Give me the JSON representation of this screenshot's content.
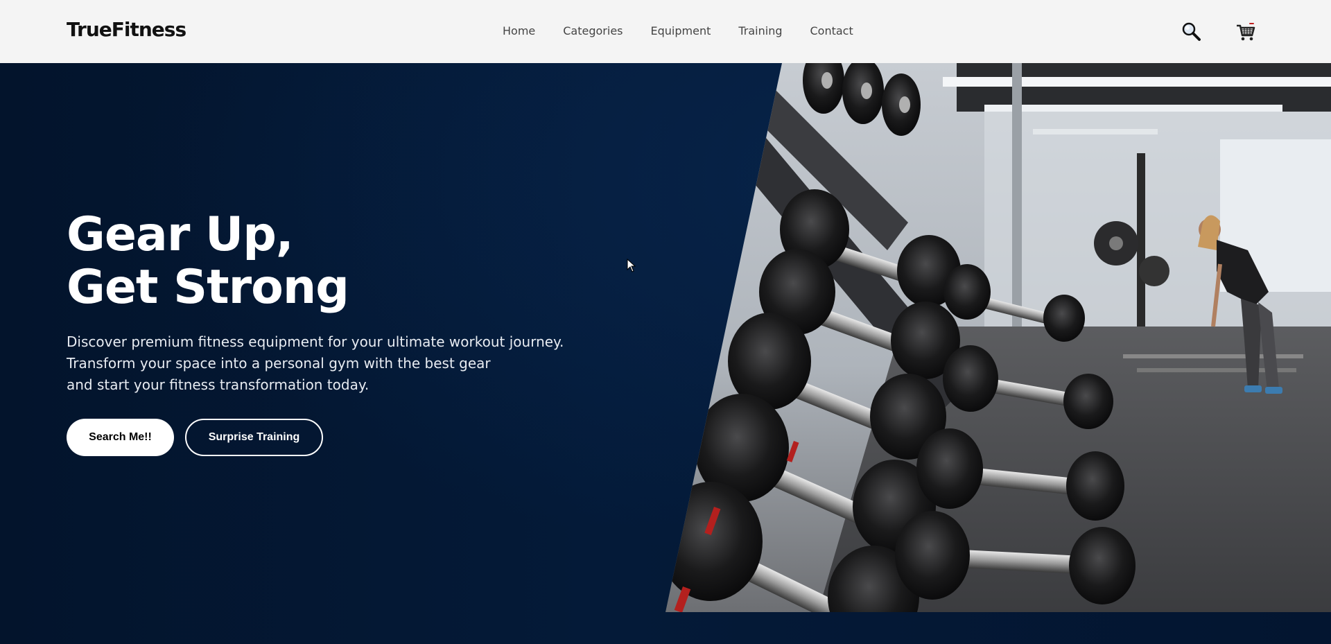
{
  "header": {
    "logo": "TrueFitness",
    "nav": [
      "Home",
      "Categories",
      "Equipment",
      "Training",
      "Contact"
    ],
    "icons": [
      "search-icon",
      "cart-icon"
    ]
  },
  "hero": {
    "title_line1": "Gear Up,",
    "title_line2": "Get Strong",
    "description": [
      "Discover premium fitness equipment for your ultimate workout journey.",
      "Transform your space into a personal gym with the best gear",
      "and start your fitness transformation today."
    ],
    "primary_button": "Search Me!!",
    "secondary_button": "Surprise Training",
    "image": "gym-dumbbell-rack-photo"
  },
  "colors": {
    "hero_background": "#041630",
    "navbar_background": "#f4f4f4",
    "text_light": "#ffffff",
    "text_dark": "#111111"
  }
}
